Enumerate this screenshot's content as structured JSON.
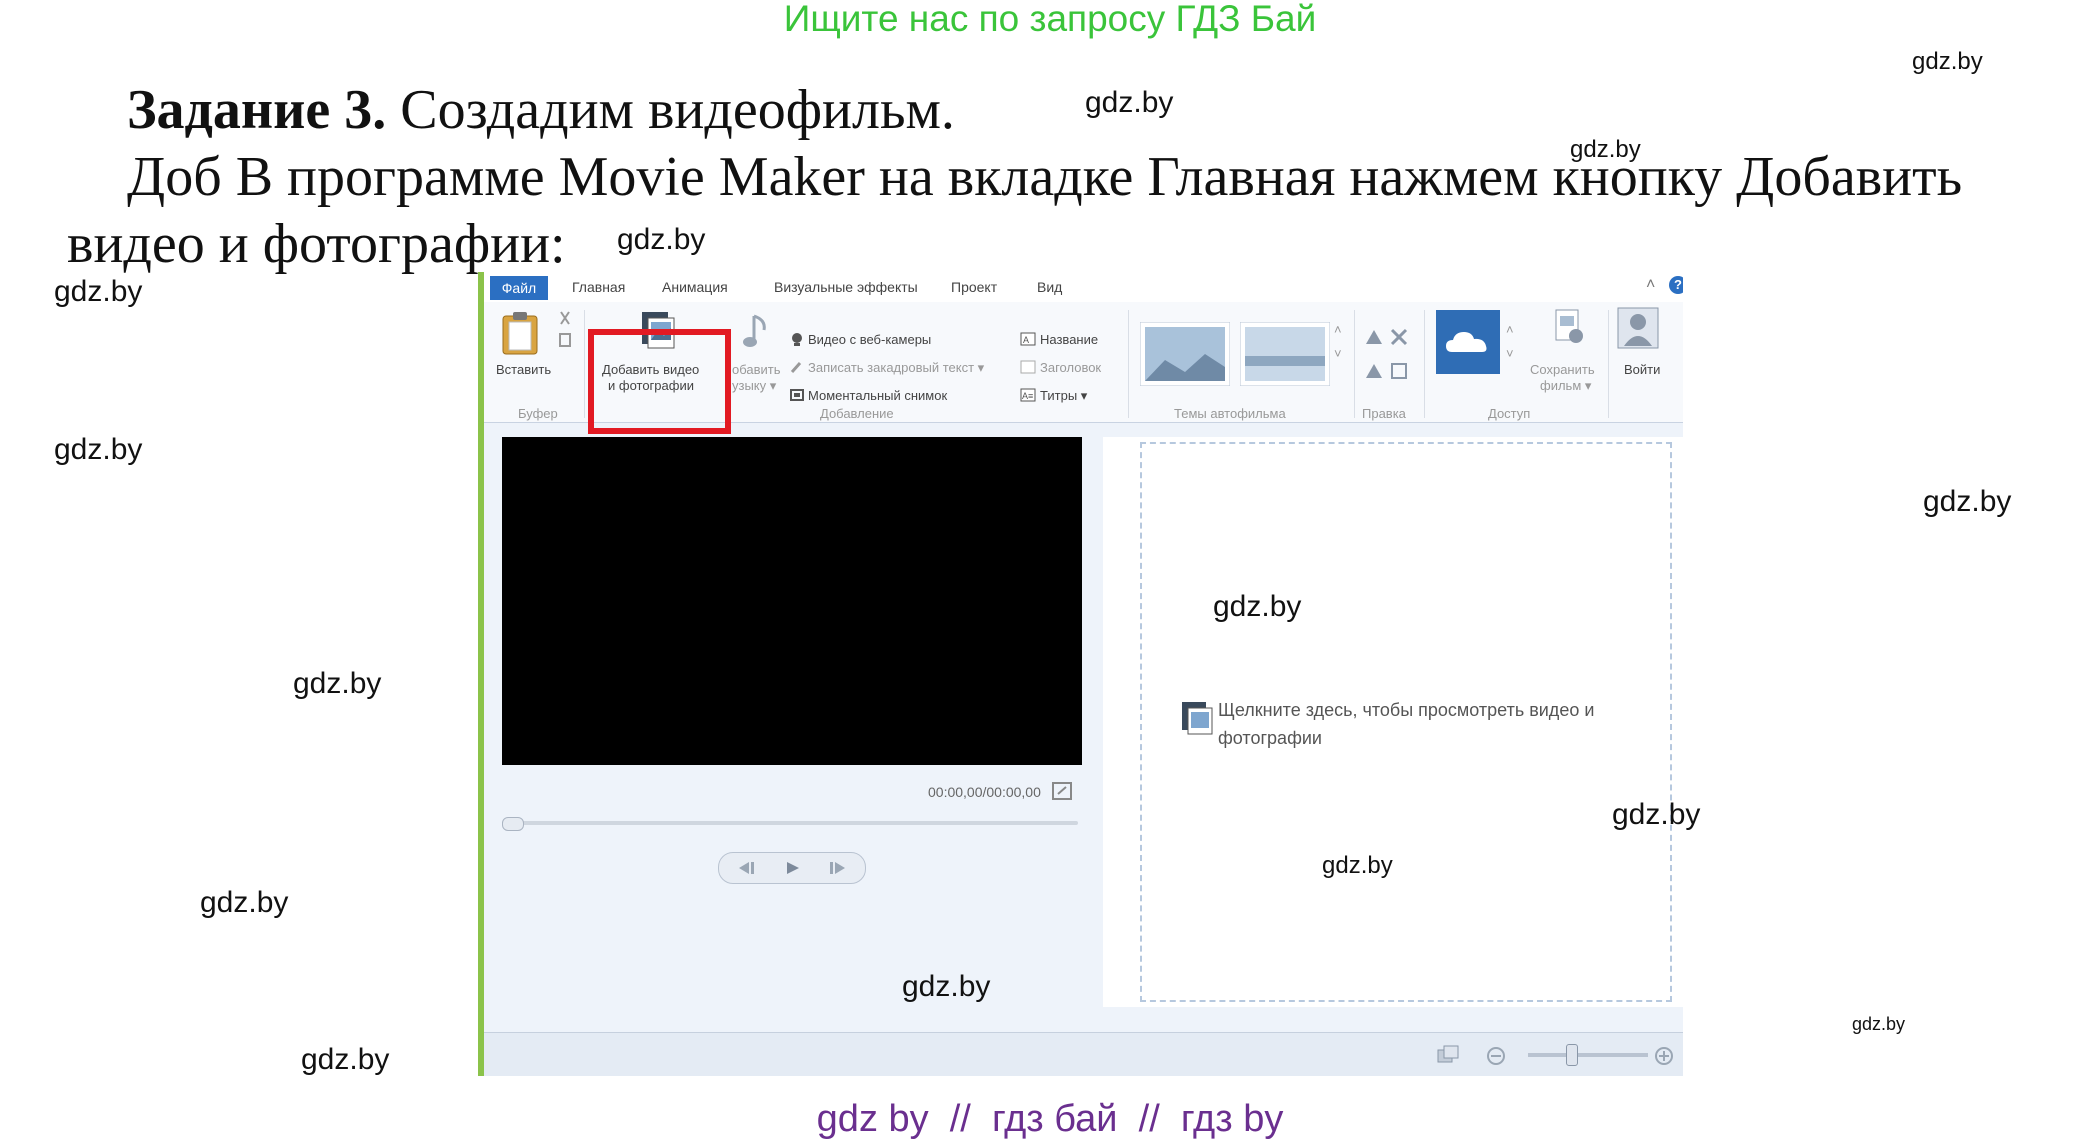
{
  "header": {
    "banner": "Ищите нас по запросу ГДЗ Бай"
  },
  "task": {
    "title_bold": "Задание 3.",
    "title_rest": " Создадим видеофильм.",
    "line2": "Доб В программе Movie Maker на вкладке Главная нажмем кнопку Добавить",
    "line3": "видео и фотографии:"
  },
  "watermark": "gdz.by",
  "footer": {
    "banner": "gdz by  //  гдз бай  //  гдз by"
  },
  "moviemaker": {
    "tabs": {
      "file": "Файл",
      "home": "Главная",
      "animation": "Анимация",
      "visual_effects": "Визуальные эффекты",
      "project": "Проект",
      "view": "Вид"
    },
    "ribbon": {
      "paste": "Вставить",
      "clipboard_group": "Буфер",
      "add_video_line1": "Добавить видео",
      "add_video_line2": "и фотографии",
      "add_music_line1": "обавить",
      "add_music_line2": "узыку ▾",
      "webcam": "Видео с веб-камеры",
      "narration": "Записать закадровый текст ▾",
      "snapshot": "Моментальный снимок",
      "add_group": "Добавление",
      "title": "Название",
      "caption": "Заголовок",
      "credits": "Титры ▾",
      "themes_group": "Темы автофильма",
      "edit_group": "Правка",
      "save_line1": "Сохранить",
      "save_line2": "фильм ▾",
      "share_group": "Доступ",
      "signin": "Войти",
      "help": "?"
    },
    "player": {
      "time": "00:00,00/00:00,00"
    },
    "storyboard": {
      "hint_line1": "Щелкните здесь, чтобы просмотреть видео и",
      "hint_line2": "фотографии"
    }
  },
  "colors": {
    "banner_green": "#3ac43a",
    "footer_purple": "#6a2f8f",
    "file_tab_blue": "#2b6fc2",
    "highlight_red": "#e21a23",
    "left_edge_green": "#8bc34a"
  }
}
